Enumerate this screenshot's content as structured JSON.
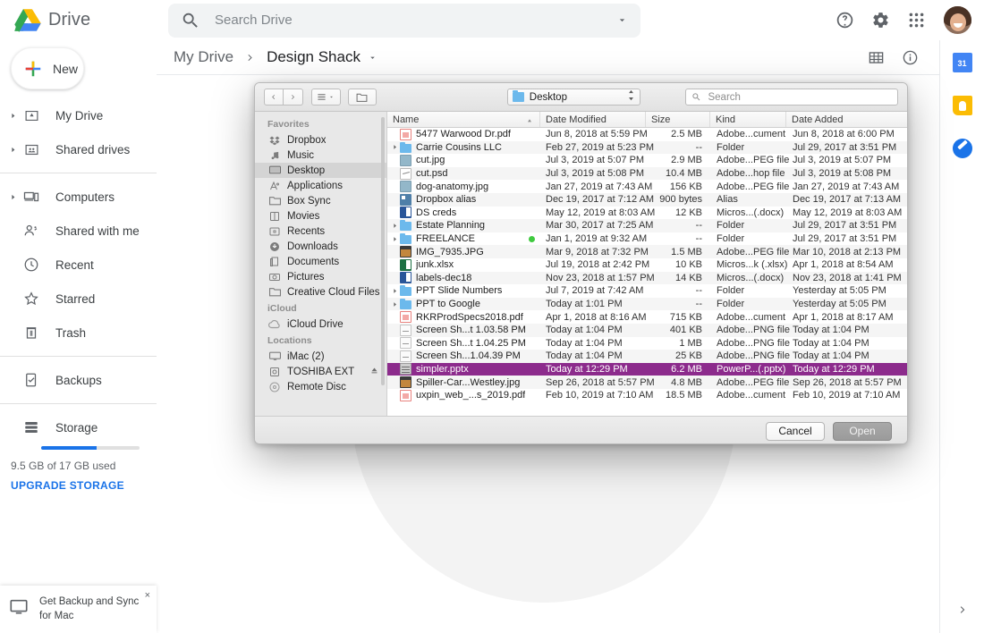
{
  "app": {
    "brand": "Drive",
    "logo_colors": {
      "blue": "#4285f4",
      "green": "#34a853",
      "yellow": "#fbbc04"
    }
  },
  "search": {
    "placeholder": "Search Drive",
    "value": "",
    "icon": "search-icon",
    "dropdown_icon": "chevron-down-icon"
  },
  "header_actions": [
    {
      "name": "help-icon",
      "label": "Help"
    },
    {
      "name": "settings-gear-icon",
      "label": "Settings"
    },
    {
      "name": "apps-grid-icon",
      "label": "Google apps"
    }
  ],
  "sidebar": {
    "new_button": "New",
    "items": [
      {
        "label": "My Drive",
        "icon": "my-drive-icon",
        "expandable": true
      },
      {
        "label": "Shared drives",
        "icon": "shared-drives-icon",
        "expandable": true
      },
      {
        "label": "Computers",
        "icon": "computers-icon",
        "expandable": true
      },
      {
        "label": "Shared with me",
        "icon": "shared-with-me-icon",
        "expandable": false
      },
      {
        "label": "Recent",
        "icon": "clock-icon",
        "expandable": false
      },
      {
        "label": "Starred",
        "icon": "star-icon",
        "expandable": false
      },
      {
        "label": "Trash",
        "icon": "trash-icon",
        "expandable": false
      },
      {
        "label": "Backups",
        "icon": "backups-icon",
        "expandable": false
      },
      {
        "label": "Storage",
        "icon": "storage-icon",
        "expandable": false
      }
    ],
    "storage": {
      "used_text": "9.5 GB of 17 GB used",
      "upgrade_label": "UPGRADE STORAGE",
      "percent": 56,
      "bar_color": "#1a73e8"
    }
  },
  "breadcrumb": {
    "root": "My Drive",
    "separator_icon": "chevron-right-icon",
    "current": "Design Shack",
    "dropdown_icon": "caret-down-icon",
    "actions": [
      {
        "name": "grid-view-icon",
        "label": "Grid view"
      },
      {
        "name": "details-info-icon",
        "label": "View details"
      }
    ]
  },
  "right_rail": {
    "apps": [
      {
        "name": "google-calendar-icon",
        "label": "Calendar",
        "glyph": "31",
        "color": "#4285f4"
      },
      {
        "name": "google-keep-icon",
        "label": "Keep",
        "glyph": "",
        "color": "#fbbc04"
      },
      {
        "name": "google-tasks-icon",
        "label": "Tasks",
        "glyph": "",
        "color": "#1a73e8"
      }
    ],
    "expand_icon": "chevron-right-icon"
  },
  "toast": {
    "icon": "desktop-monitor-icon",
    "text": "Get Backup and Sync for Mac",
    "close": "×"
  },
  "file_dialog": {
    "toolbar": {
      "back_icon": "chevron-left-icon",
      "forward_icon": "chevron-right-icon",
      "view_options_icon": "list-view-icon",
      "group_icon": "folder-actions-icon",
      "path_label": "Desktop",
      "path_icon": "folder-icon",
      "path_stepper_icon": "up-down-stepper-icon",
      "search_placeholder": "Search",
      "search_value": "",
      "search_icon": "search-icon"
    },
    "sidebar": {
      "sections": [
        {
          "title": "Favorites",
          "items": [
            {
              "label": "Dropbox",
              "icon": "dropbox-icon",
              "selected": false
            },
            {
              "label": "Music",
              "icon": "music-note-icon",
              "selected": false
            },
            {
              "label": "Desktop",
              "icon": "desktop-icon",
              "selected": true
            },
            {
              "label": "Applications",
              "icon": "applications-icon",
              "selected": false
            },
            {
              "label": "Box Sync",
              "icon": "folder-icon",
              "selected": false
            },
            {
              "label": "Movies",
              "icon": "movies-icon",
              "selected": false
            },
            {
              "label": "Recents",
              "icon": "recents-icon",
              "selected": false
            },
            {
              "label": "Downloads",
              "icon": "download-icon",
              "selected": false
            },
            {
              "label": "Documents",
              "icon": "documents-icon",
              "selected": false
            },
            {
              "label": "Pictures",
              "icon": "camera-icon",
              "selected": false
            },
            {
              "label": "Creative Cloud Files",
              "icon": "folder-icon",
              "selected": false
            }
          ]
        },
        {
          "title": "iCloud",
          "items": [
            {
              "label": "iCloud Drive",
              "icon": "cloud-icon",
              "selected": false
            }
          ]
        },
        {
          "title": "Locations",
          "items": [
            {
              "label": "iMac (2)",
              "icon": "imac-icon",
              "selected": false
            },
            {
              "label": "TOSHIBA EXT",
              "icon": "drive-icon",
              "selected": false,
              "eject": true
            },
            {
              "label": "Remote Disc",
              "icon": "disc-icon",
              "selected": false
            }
          ]
        }
      ]
    },
    "columns": [
      {
        "key": "name",
        "label": "Name",
        "sorted": true
      },
      {
        "key": "date",
        "label": "Date Modified",
        "sorted": false
      },
      {
        "key": "size",
        "label": "Size",
        "sorted": false
      },
      {
        "key": "kind",
        "label": "Kind",
        "sorted": false
      },
      {
        "key": "added",
        "label": "Date Added",
        "sorted": false
      }
    ],
    "files": [
      {
        "name": "5477 Warwood Dr.pdf",
        "date": "Jun 8, 2018 at 5:59 PM",
        "size": "2.5 MB",
        "kind": "Adobe...cument",
        "added": "Jun 8, 2018 at 6:00 PM",
        "icon": "pdf-file-icon",
        "expandable": false,
        "selected": false,
        "tag": false
      },
      {
        "name": "Carrie Cousins LLC",
        "date": "Feb 27, 2019 at 5:23 PM",
        "size": "--",
        "kind": "Folder",
        "added": "Jul 29, 2017 at 3:51 PM",
        "icon": "folder-icon",
        "expandable": true,
        "selected": false,
        "tag": false
      },
      {
        "name": "cut.jpg",
        "date": "Jul 3, 2019 at 5:07 PM",
        "size": "2.9 MB",
        "kind": "Adobe...PEG file",
        "added": "Jul 3, 2019 at 5:07 PM",
        "icon": "jpeg-file-icon",
        "expandable": false,
        "selected": false,
        "tag": false
      },
      {
        "name": "cut.psd",
        "date": "Jul 3, 2019 at 5:08 PM",
        "size": "10.4 MB",
        "kind": "Adobe...hop file",
        "added": "Jul 3, 2019 at 5:08 PM",
        "icon": "psd-file-icon",
        "expandable": false,
        "selected": false,
        "tag": false
      },
      {
        "name": "dog-anatomy.jpg",
        "date": "Jan 27, 2019 at 7:43 AM",
        "size": "156 KB",
        "kind": "Adobe...PEG file",
        "added": "Jan 27, 2019 at 7:43 AM",
        "icon": "jpeg-file-icon",
        "expandable": false,
        "selected": false,
        "tag": false
      },
      {
        "name": "Dropbox alias",
        "date": "Dec 19, 2017 at 7:12 AM",
        "size": "900 bytes",
        "kind": "Alias",
        "added": "Dec 19, 2017 at 7:13 AM",
        "icon": "alias-icon",
        "expandable": false,
        "selected": false,
        "tag": false
      },
      {
        "name": "DS creds",
        "date": "May 12, 2019 at 8:03 AM",
        "size": "12 KB",
        "kind": "Micros...(.docx)",
        "added": "May 12, 2019 at 8:03 AM",
        "icon": "word-file-icon",
        "expandable": false,
        "selected": false,
        "tag": false
      },
      {
        "name": "Estate Planning",
        "date": "Mar 30, 2017 at 7:25 AM",
        "size": "--",
        "kind": "Folder",
        "added": "Jul 29, 2017 at 3:51 PM",
        "icon": "folder-icon",
        "expandable": true,
        "selected": false,
        "tag": false
      },
      {
        "name": "FREELANCE",
        "date": "Jan 1, 2019 at 9:32 AM",
        "size": "--",
        "kind": "Folder",
        "added": "Jul 29, 2017 at 3:51 PM",
        "icon": "folder-icon",
        "expandable": true,
        "selected": false,
        "tag": true
      },
      {
        "name": "IMG_7935.JPG",
        "date": "Mar 9, 2018 at 7:32 PM",
        "size": "1.5 MB",
        "kind": "Adobe...PEG file",
        "added": "Mar 10, 2018 at 2:13 PM",
        "icon": "photo-file-icon",
        "expandable": false,
        "selected": false,
        "tag": false
      },
      {
        "name": "junk.xlsx",
        "date": "Jul 19, 2018 at 2:42 PM",
        "size": "10 KB",
        "kind": "Micros...k (.xlsx)",
        "added": "Apr 1, 2018 at 8:54 AM",
        "icon": "excel-file-icon",
        "expandable": false,
        "selected": false,
        "tag": false
      },
      {
        "name": "labels-dec18",
        "date": "Nov 23, 2018 at 1:57 PM",
        "size": "14 KB",
        "kind": "Micros...(.docx)",
        "added": "Nov 23, 2018 at 1:41 PM",
        "icon": "word-file-icon",
        "expandable": false,
        "selected": false,
        "tag": false
      },
      {
        "name": "PPT Slide Numbers",
        "date": "Jul 7, 2019 at 7:42 AM",
        "size": "--",
        "kind": "Folder",
        "added": "Yesterday at 5:05 PM",
        "icon": "folder-icon",
        "expandable": true,
        "selected": false,
        "tag": false
      },
      {
        "name": "PPT to Google",
        "date": "Today at 1:01 PM",
        "size": "--",
        "kind": "Folder",
        "added": "Yesterday at 5:05 PM",
        "icon": "folder-icon",
        "expandable": true,
        "selected": false,
        "tag": false
      },
      {
        "name": "RKRProdSpecs2018.pdf",
        "date": "Apr 1, 2018 at 8:16 AM",
        "size": "715 KB",
        "kind": "Adobe...cument",
        "added": "Apr 1, 2018 at 8:17 AM",
        "icon": "pdf-file-icon",
        "expandable": false,
        "selected": false,
        "tag": false
      },
      {
        "name": "Screen Sh...t 1.03.58 PM",
        "date": "Today at 1:04 PM",
        "size": "401 KB",
        "kind": "Adobe...PNG file",
        "added": "Today at 1:04 PM",
        "icon": "png-file-icon",
        "expandable": false,
        "selected": false,
        "tag": false
      },
      {
        "name": "Screen Sh...t 1.04.25 PM",
        "date": "Today at 1:04 PM",
        "size": "1 MB",
        "kind": "Adobe...PNG file",
        "added": "Today at 1:04 PM",
        "icon": "png-file-icon",
        "expandable": false,
        "selected": false,
        "tag": false
      },
      {
        "name": "Screen Sh...1.04.39 PM",
        "date": "Today at 1:04 PM",
        "size": "25 KB",
        "kind": "Adobe...PNG file",
        "added": "Today at 1:04 PM",
        "icon": "png-file-icon",
        "expandable": false,
        "selected": false,
        "tag": false
      },
      {
        "name": "simpler.pptx",
        "date": "Today at 12:29 PM",
        "size": "6.2 MB",
        "kind": "PowerP...(.pptx)",
        "added": "Today at 12:29 PM",
        "icon": "ppt-file-icon",
        "expandable": false,
        "selected": true,
        "tag": false
      },
      {
        "name": "Spiller-Car...Westley.jpg",
        "date": "Sep 26, 2018 at 5:57 PM",
        "size": "4.8 MB",
        "kind": "Adobe...PEG file",
        "added": "Sep 26, 2018 at 5:57 PM",
        "icon": "photo-file-icon",
        "expandable": false,
        "selected": false,
        "tag": false
      },
      {
        "name": "uxpin_web_...s_2019.pdf",
        "date": "Feb 10, 2019 at 7:10 AM",
        "size": "18.5 MB",
        "kind": "Adobe...cument",
        "added": "Feb 10, 2019 at 7:10 AM",
        "icon": "pdf-file-icon",
        "expandable": false,
        "selected": false,
        "tag": false
      }
    ],
    "footer": {
      "cancel_label": "Cancel",
      "open_label": "Open",
      "selection_color": "#8c2b8c"
    }
  }
}
